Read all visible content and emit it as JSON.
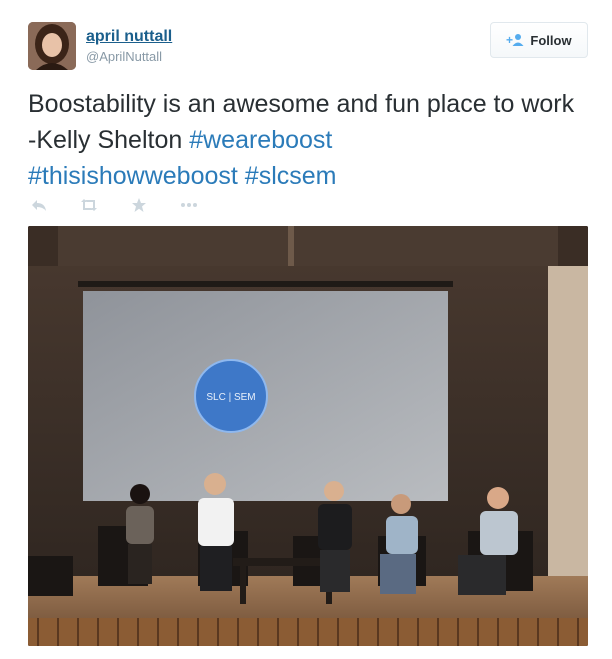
{
  "user": {
    "full_name": "april nuttall",
    "handle": "@AprilNuttall"
  },
  "follow_button": {
    "label": "Follow"
  },
  "tweet": {
    "text_prefix": "Boostability is an awesome and fun place to work -Kelly Shelton  ",
    "hashtags": [
      "#weareboost",
      "#thisishowweboost",
      "#slcsem"
    ]
  },
  "actions": [
    "reply-icon",
    "retweet-icon",
    "favorite-icon",
    "more-icon"
  ],
  "photo": {
    "screen_logo_text": "SLC | SEM"
  },
  "colors": {
    "link": "#2b7bb9",
    "name": "#1b5f8c",
    "muted": "#8899a6",
    "text": "#292f33"
  }
}
